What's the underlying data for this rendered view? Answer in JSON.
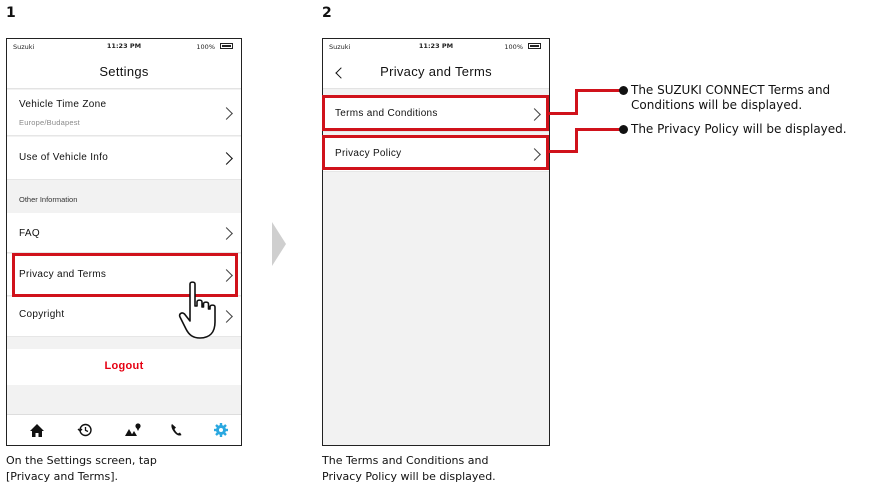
{
  "steps": [
    "1",
    "2"
  ],
  "status_bar": {
    "carrier": "Suzuki",
    "time": "11:23 PM",
    "battery": "100%"
  },
  "screen1": {
    "title": "Settings",
    "items": [
      {
        "label": "Vehicle Time Zone",
        "sub": "Europe/Budapest"
      },
      {
        "label": "Use of Vehicle Info"
      },
      {
        "label": "FAQ"
      },
      {
        "label": "Privacy and Terms"
      },
      {
        "label": "Copyright"
      }
    ],
    "section_label": "Other Information",
    "logout_label": "Logout",
    "tabs": [
      "home-icon",
      "history-icon",
      "map-icon",
      "phone-icon",
      "gear-icon"
    ],
    "accent_color": "#2aa8e0",
    "caption": [
      "On the Settings screen, tap",
      "[Privacy and Terms]."
    ]
  },
  "screen2": {
    "title": "Privacy and Terms",
    "items": [
      {
        "label": "Terms and Conditions"
      },
      {
        "label": "Privacy Policy"
      }
    ],
    "caption": [
      "The Terms and Conditions and",
      "Privacy Policy will be displayed."
    ]
  },
  "notes": {
    "terms": [
      "The SUZUKI CONNECT Terms and",
      "Conditions will be displayed."
    ],
    "privacy": "The Privacy Policy will be displayed."
  },
  "highlight_color": "#d0121b"
}
